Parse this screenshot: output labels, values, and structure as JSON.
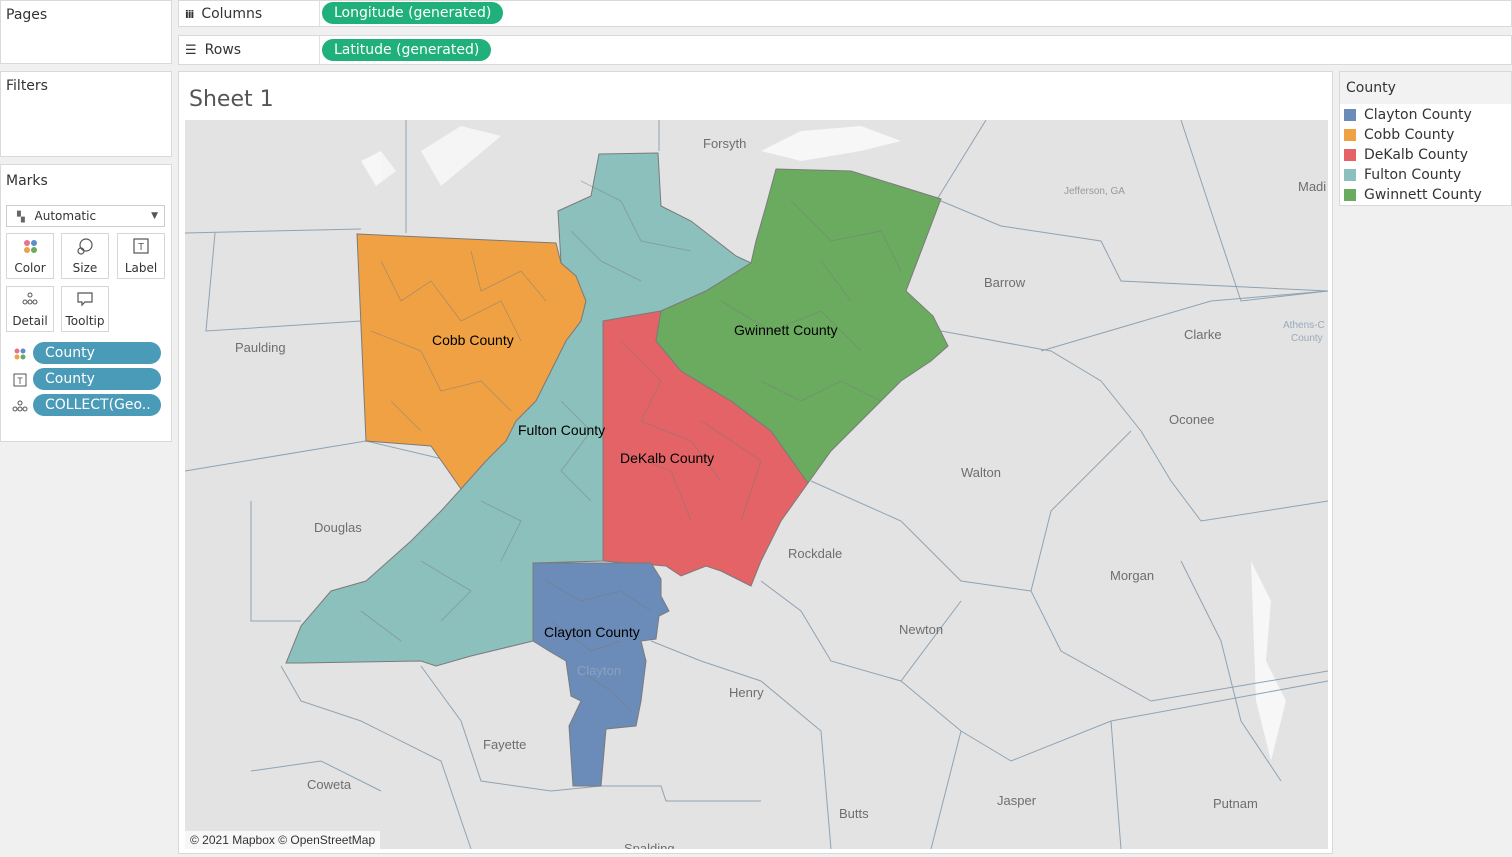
{
  "shelves": {
    "pages_label": "Pages",
    "columns_label": "Columns",
    "columns_pill": "Longitude (generated)",
    "rows_label": "Rows",
    "rows_pill": "Latitude (generated)",
    "filters_label": "Filters"
  },
  "marks": {
    "title": "Marks",
    "mark_type": "Automatic",
    "buttons": [
      "Color",
      "Size",
      "Label",
      "Detail",
      "Tooltip"
    ],
    "pills": [
      {
        "icon": "color-dots-icon",
        "label": "County"
      },
      {
        "icon": "label-icon",
        "label": "County"
      },
      {
        "icon": "detail-dots-icon",
        "label": "COLLECT(Geo.."
      }
    ]
  },
  "sheet": {
    "title": "Sheet 1",
    "attribution": "© 2021 Mapbox © OpenStreetMap"
  },
  "legend": {
    "title": "County",
    "items": [
      {
        "label": "Clayton County",
        "color": "#6b8bb8"
      },
      {
        "label": "Cobb County",
        "color": "#f0a143"
      },
      {
        "label": "DeKalb County",
        "color": "#e36366"
      },
      {
        "label": "Fulton County",
        "color": "#8cc0bc"
      },
      {
        "label": "Gwinnett County",
        "color": "#6aab5f"
      }
    ]
  },
  "map": {
    "county_labels": [
      "Cobb County",
      "Fulton County",
      "DeKalb County",
      "Gwinnett County",
      "Clayton County"
    ],
    "basemap_labels": [
      "Forsyth",
      "Jefferson, GA",
      "Madi",
      "Barrow",
      "Clarke",
      "Athens-C",
      "County",
      "Paulding",
      "Oconee",
      "Walton",
      "Douglas",
      "Rockdale",
      "Morgan",
      "Newton",
      "Clayton",
      "Henry",
      "Fayette",
      "Coweta",
      "Butts",
      "Jasper",
      "Putnam",
      "Spalding"
    ]
  }
}
